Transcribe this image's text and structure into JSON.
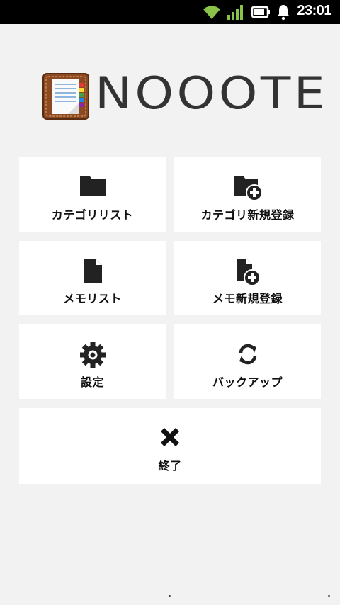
{
  "status_bar": {
    "time": "23:01",
    "icons": [
      "wifi-icon",
      "signal-icon",
      "battery-icon",
      "notification-bell-icon"
    ]
  },
  "app": {
    "logo_text": "NOOOTE",
    "logo_icon": "notebook-icon"
  },
  "menu": {
    "category_list": {
      "label": "カテゴリリスト",
      "icon": "folder-icon"
    },
    "category_new": {
      "label": "カテゴリ新規登録",
      "icon": "folder-add-icon"
    },
    "memo_list": {
      "label": "メモリスト",
      "icon": "document-icon"
    },
    "memo_new": {
      "label": "メモ新規登録",
      "icon": "document-add-icon"
    },
    "settings": {
      "label": "設定",
      "icon": "gear-icon"
    },
    "backup": {
      "label": "バックアップ",
      "icon": "sync-icon"
    },
    "exit": {
      "label": "終了",
      "icon": "close-icon"
    }
  },
  "colors": {
    "background": "#f2f2f2",
    "tile": "#ffffff",
    "icon": "#222222",
    "status_bar": "#000000",
    "wifi": "#8bc34a"
  }
}
